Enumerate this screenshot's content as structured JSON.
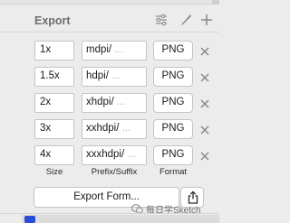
{
  "panel": {
    "title": "Export"
  },
  "export_rows": [
    {
      "size": "1x",
      "prefix": "mdpi/",
      "format": "PNG"
    },
    {
      "size": "1.5x",
      "prefix": "hdpi/",
      "format": "PNG"
    },
    {
      "size": "2x",
      "prefix": "xhdpi/",
      "format": "PNG"
    },
    {
      "size": "3x",
      "prefix": "xxhdpi/",
      "format": "PNG"
    },
    {
      "size": "4x",
      "prefix": "xxxhdpi/",
      "format": "PNG"
    }
  ],
  "prefix_placeholder": "...",
  "column_labels": {
    "size": "Size",
    "prefix": "Prefix/Suffix",
    "format": "Format"
  },
  "export_button": "Export Form...",
  "watermark": "每日学Sketch",
  "icons": {
    "settings": "sliders-icon",
    "slice": "knife-icon",
    "add": "plus-icon",
    "remove": "x-icon",
    "share": "share-icon"
  },
  "colors": {
    "accent_bottom": "#2a4bd7"
  }
}
